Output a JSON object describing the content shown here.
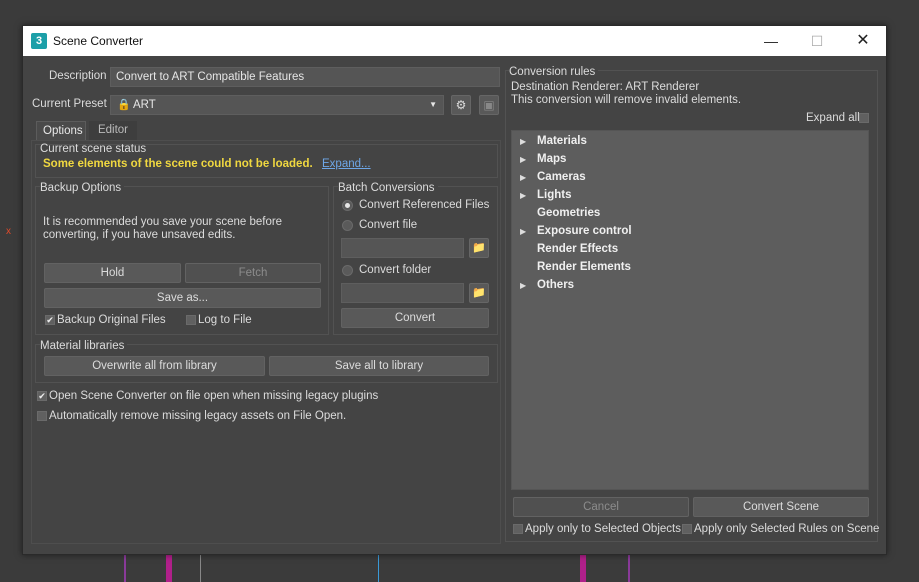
{
  "window": {
    "title": "Scene Converter",
    "app_icon_text": "3",
    "minimize": "—",
    "maximize": "☐",
    "close": "✕"
  },
  "background": {
    "axis_label": "x"
  },
  "description": {
    "label": "Description",
    "value": "Convert to ART Compatible Features"
  },
  "preset": {
    "label": "Current Preset",
    "value": "ART"
  },
  "tabs": [
    {
      "label": "Options"
    },
    {
      "label": "Editor"
    }
  ],
  "scene_status": {
    "title": "Current scene status",
    "message": "Some elements of the scene could not be loaded.",
    "expand_link": "Expand..."
  },
  "backup": {
    "title": "Backup Options",
    "text_line1": "It is recommended you save your scene before",
    "text_line2": "converting, if you have unsaved edits.",
    "hold": "Hold",
    "fetch": "Fetch",
    "save_as": "Save as...",
    "backup_original": "Backup Original Files",
    "log_to_file": "Log to File"
  },
  "batch": {
    "title": "Batch Conversions",
    "referenced": "Convert Referenced Files",
    "file": "Convert file",
    "folder": "Convert folder",
    "convert": "Convert"
  },
  "material_libraries": {
    "title": "Material libraries",
    "overwrite": "Overwrite all from library",
    "save_all": "Save all to library"
  },
  "options": {
    "open_on_missing": "Open Scene Converter on file open when missing legacy plugins",
    "auto_remove": "Automatically remove missing legacy assets on File Open."
  },
  "rules": {
    "title": "Conversion rules",
    "destination": "Destination Renderer: ART Renderer",
    "note": "This conversion will remove invalid elements.",
    "expand_all": "Expand all",
    "items": [
      {
        "label": "Materials",
        "arrow": "▶"
      },
      {
        "label": "Maps",
        "arrow": "▶"
      },
      {
        "label": "Cameras",
        "arrow": "▶"
      },
      {
        "label": "Lights",
        "arrow": "▶"
      },
      {
        "label": "Geometries",
        "arrow": ""
      },
      {
        "label": "Exposure control",
        "arrow": "▶"
      },
      {
        "label": "Render Effects",
        "arrow": ""
      },
      {
        "label": "Render Elements",
        "arrow": ""
      },
      {
        "label": "Others",
        "arrow": "▶"
      }
    ],
    "cancel": "Cancel",
    "convert_scene": "Convert Scene",
    "apply_selected_objects": "Apply only to Selected Objects",
    "apply_selected_rules": "Apply only Selected Rules on Scene"
  },
  "colors": {
    "status_warning": "#f0d840",
    "link": "#6ea7e8"
  }
}
